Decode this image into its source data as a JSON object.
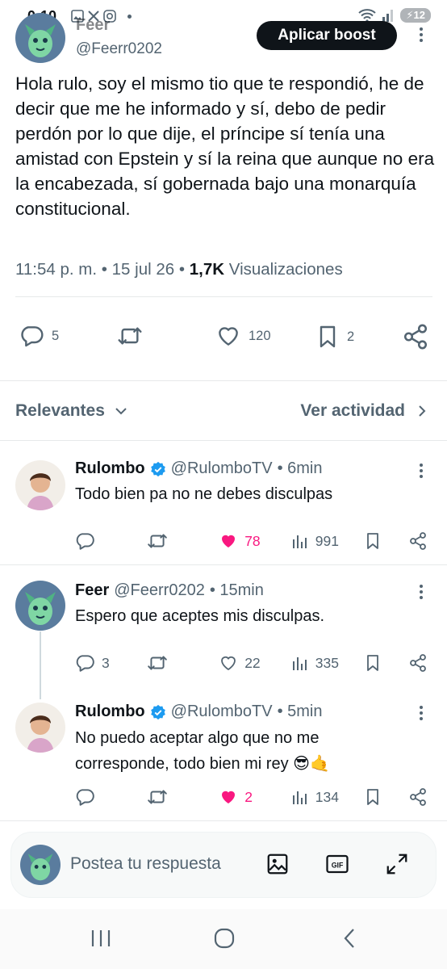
{
  "status_bar": {
    "time": "0:10",
    "battery": "12"
  },
  "tweet": {
    "author_name": "Feer",
    "author_handle": "@Feerr0202",
    "boost_button": "Aplicar boost",
    "text": "Hola rulo, soy el mismo tio que te respondió, he de decir que me he informado y sí, debo de pedir perdón por lo que dije, el príncipe sí tenía una amistad con Epstein y sí la reina que aunque no era la encabezada, sí gobernada bajo una monarquía constitucional.",
    "time": "11:54 p. m.",
    "date": "15 jul 26",
    "views_count": "1,7K",
    "views_label": "Visualizaciones",
    "separator": "•",
    "replies": "5",
    "likes": "120",
    "bookmarks": "2"
  },
  "replies_header": {
    "sort_label": "Relevantes",
    "activity_label": "Ver actividad"
  },
  "replies": [
    {
      "name": "Rulombo",
      "handle": "@RulomboTV",
      "time": "• 6min",
      "text": "Todo bien pa no ne debes disculpas",
      "reply_count": "",
      "like_count": "78",
      "liked": true,
      "views": "991"
    },
    {
      "name": "Feer",
      "handle": "@Feerr0202",
      "time": "• 15min",
      "text": "Espero que aceptes mis disculpas.",
      "reply_count": "3",
      "like_count": "22",
      "liked": false,
      "views": "335"
    },
    {
      "name": "Rulombo",
      "handle": "@RulomboTV",
      "time": "• 5min",
      "text": "No puedo aceptar algo que no me corresponde, todo bien mi rey 😎🤙",
      "reply_count": "",
      "like_count": "2",
      "liked": true,
      "views": "134"
    }
  ],
  "composer": {
    "placeholder": "Postea tu respuesta"
  },
  "colors": {
    "like_pink": "#f91880",
    "verified_blue": "#1d9bf0",
    "muted": "#536471",
    "text": "#0f1419"
  }
}
